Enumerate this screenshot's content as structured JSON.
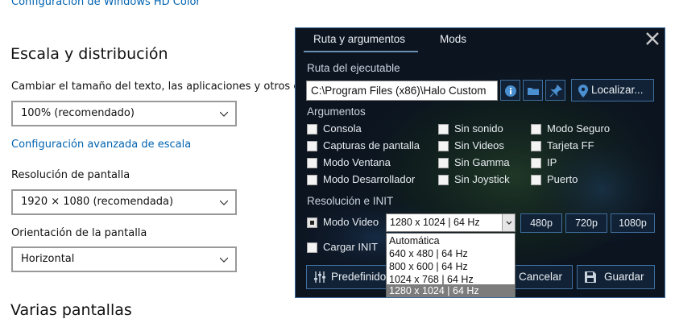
{
  "settings": {
    "top_link": "Configuración de Windows HD Color",
    "section_scale": "Escala y distribución",
    "text_size_label": "Cambiar el tamaño del texto, las aplicaciones y otros elem",
    "scale_value": "100% (recomendado)",
    "advanced_scale_link": "Configuración avanzada de escala",
    "resolution_label": "Resolución de pantalla",
    "resolution_value": "1920 × 1080 (recomendada)",
    "orientation_label": "Orientación de la pantalla",
    "orientation_value": "Horizontal",
    "section_multi": "Varias pantallas"
  },
  "launcher": {
    "tabs": [
      "Ruta y argumentos",
      "Mods"
    ],
    "path_section": "Ruta del ejecutable",
    "path_value": "C:\\Program Files (x86)\\Halo Custom",
    "locate_label": "Localizar...",
    "args_section": "Argumentos",
    "args": [
      "Consola",
      "Sin sonido",
      "Modo Seguro",
      "Capturas de pantalla",
      "Sin Videos",
      "Tarjeta FF",
      "Modo Ventana",
      "Sin Gamma",
      "IP",
      "Modo Desarrollador",
      "Sin Joystick",
      "Puerto"
    ],
    "res_section": "Resolución e INIT",
    "video_mode_label": "Modo Video",
    "video_mode_value": "1280 x 1024 | 64 Hz",
    "res_buttons": [
      "480p",
      "720p",
      "1080p"
    ],
    "load_init_label": "Cargar INIT",
    "dropdown_options": [
      "Automática",
      "640 x 480 | 64 Hz",
      "800 x 600 | 64 Hz",
      "1024 x 768 | 64 Hz",
      "1280 x 1024 | 64 Hz"
    ],
    "preset_label": "Predefinido",
    "cancel_label": "Cancelar",
    "save_label": "Guardar",
    "icons": [
      "close-icon",
      "info-icon",
      "folder-icon",
      "pin-icon",
      "location-icon",
      "sliders-icon",
      "save-icon"
    ],
    "accent_color": "#3f6f9e"
  }
}
